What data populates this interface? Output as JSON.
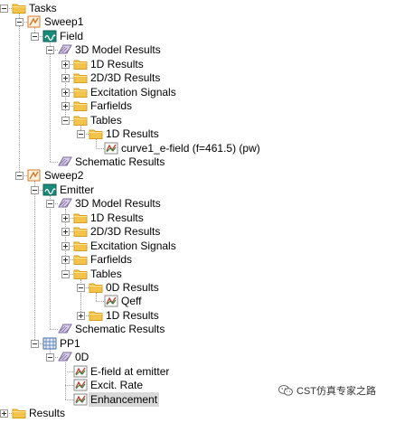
{
  "tree": {
    "rows": [
      {
        "id": "tasks",
        "label": "Tasks",
        "level": 0,
        "icon": "folder-icon",
        "expander": "expanded"
      },
      {
        "id": "sweep1",
        "label": "Sweep1",
        "level": 1,
        "icon": "sweep-icon",
        "expander": "expanded"
      },
      {
        "id": "field",
        "label": "Field",
        "level": 2,
        "icon": "monitor-icon",
        "expander": "expanded"
      },
      {
        "id": "3d-model-results-1",
        "label": "3D Model Results",
        "level": 3,
        "icon": "results-icon",
        "expander": "expanded"
      },
      {
        "id": "1d-results-1",
        "label": "1D Results",
        "level": 4,
        "icon": "folder-icon",
        "expander": "collapsed"
      },
      {
        "id": "2d3d-results-1",
        "label": "2D/3D Results",
        "level": 4,
        "icon": "folder-icon",
        "expander": "collapsed"
      },
      {
        "id": "excitation-signals-1",
        "label": "Excitation Signals",
        "level": 4,
        "icon": "folder-icon",
        "expander": "collapsed"
      },
      {
        "id": "farfields-1",
        "label": "Farfields",
        "level": 4,
        "icon": "folder-icon",
        "expander": "collapsed"
      },
      {
        "id": "tables-1",
        "label": "Tables",
        "level": 4,
        "icon": "folder-icon",
        "expander": "expanded"
      },
      {
        "id": "tables-1d-results-1",
        "label": "1D Results",
        "level": 5,
        "icon": "folder-icon",
        "expander": "expanded"
      },
      {
        "id": "curve1",
        "label": "curve1_e-field (f=461.5) (pw)",
        "level": 6,
        "icon": "curve-icon",
        "expander": "none"
      },
      {
        "id": "schematic-results-1",
        "label": "Schematic Results",
        "level": 3,
        "icon": "results-icon",
        "expander": "none"
      },
      {
        "id": "sweep2",
        "label": "Sweep2",
        "level": 1,
        "icon": "sweep-icon",
        "expander": "expanded"
      },
      {
        "id": "emitter",
        "label": "Emitter",
        "level": 2,
        "icon": "monitor-icon",
        "expander": "expanded"
      },
      {
        "id": "3d-model-results-2",
        "label": "3D Model Results",
        "level": 3,
        "icon": "results-icon",
        "expander": "expanded"
      },
      {
        "id": "1d-results-2",
        "label": "1D Results",
        "level": 4,
        "icon": "folder-icon",
        "expander": "collapsed"
      },
      {
        "id": "2d3d-results-2",
        "label": "2D/3D Results",
        "level": 4,
        "icon": "folder-icon",
        "expander": "collapsed"
      },
      {
        "id": "excitation-signals-2",
        "label": "Excitation Signals",
        "level": 4,
        "icon": "folder-icon",
        "expander": "collapsed"
      },
      {
        "id": "farfields-2",
        "label": "Farfields",
        "level": 4,
        "icon": "folder-icon",
        "expander": "collapsed"
      },
      {
        "id": "tables-2",
        "label": "Tables",
        "level": 4,
        "icon": "folder-icon",
        "expander": "expanded"
      },
      {
        "id": "0d-results",
        "label": "0D Results",
        "level": 5,
        "icon": "folder-icon",
        "expander": "expanded"
      },
      {
        "id": "qeff",
        "label": "Qeff",
        "level": 6,
        "icon": "curve-icon",
        "expander": "none"
      },
      {
        "id": "tables-1d-results-2",
        "label": "1D Results",
        "level": 5,
        "icon": "folder-icon",
        "expander": "collapsed"
      },
      {
        "id": "schematic-results-2",
        "label": "Schematic Results",
        "level": 3,
        "icon": "results-icon",
        "expander": "none"
      },
      {
        "id": "pp1",
        "label": "PP1",
        "level": 2,
        "icon": "postprocess-icon",
        "expander": "expanded"
      },
      {
        "id": "0d",
        "label": "0D",
        "level": 3,
        "icon": "results-icon",
        "expander": "expanded"
      },
      {
        "id": "e-field-at-emitter",
        "label": "E-field at emitter",
        "level": 4,
        "icon": "curve-icon",
        "expander": "none"
      },
      {
        "id": "excit-rate",
        "label": "Excit. Rate",
        "level": 4,
        "icon": "curve-icon",
        "expander": "none"
      },
      {
        "id": "enhancement",
        "label": "Enhancement",
        "level": 4,
        "icon": "curve-icon",
        "expander": "none",
        "selected": true
      },
      {
        "id": "results",
        "label": "Results",
        "level": 0,
        "icon": "folder-icon",
        "expander": "collapsed"
      }
    ]
  },
  "watermark": {
    "text": "CST仿真专家之路",
    "icon": "wechat-icon"
  },
  "colors": {
    "folder": "#f3c34c",
    "folder_dark": "#d4a020",
    "selected_bg": "#d9d9d9",
    "tree_line": "#a0a0a0",
    "monitor": "#1a8a7a",
    "sweep": "#d4782a"
  }
}
